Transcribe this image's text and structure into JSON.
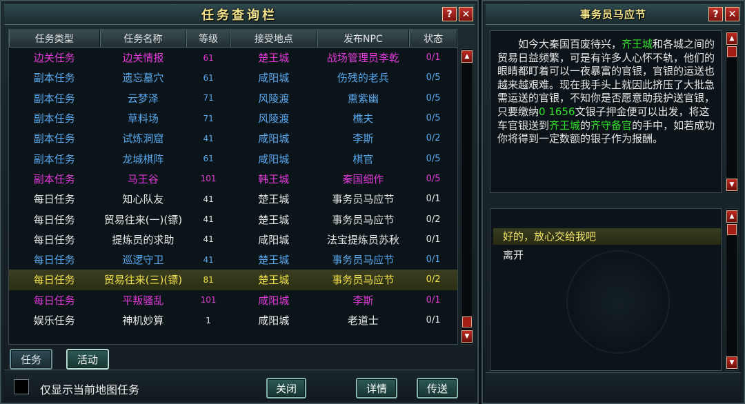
{
  "quest_panel": {
    "title": "任务查询栏",
    "help_label": "?",
    "close_label": "✕",
    "columns": [
      "任务类型",
      "任务名称",
      "等级",
      "接受地点",
      "发布NPC",
      "状态"
    ],
    "rows": [
      {
        "type": "边关任务",
        "name": "边关情报",
        "level": "61",
        "place": "楚王城",
        "npc": "战场管理员李乾",
        "status": "0/1",
        "color": "#e23ad8"
      },
      {
        "type": "副本任务",
        "name": "遗忘墓穴",
        "level": "61",
        "place": "咸阳城",
        "npc": "伤残的老兵",
        "status": "0/5",
        "color": "#5aa9f0"
      },
      {
        "type": "副本任务",
        "name": "云梦泽",
        "level": "71",
        "place": "风陵渡",
        "npc": "熏紫幽",
        "status": "0/5",
        "color": "#5aa9f0"
      },
      {
        "type": "副本任务",
        "name": "草料场",
        "level": "71",
        "place": "风陵渡",
        "npc": "樵夫",
        "status": "0/5",
        "color": "#5aa9f0"
      },
      {
        "type": "副本任务",
        "name": "试炼洞窟",
        "level": "41",
        "place": "咸阳城",
        "npc": "李斯",
        "status": "0/2",
        "color": "#5aa9f0"
      },
      {
        "type": "副本任务",
        "name": "龙城棋阵",
        "level": "61",
        "place": "咸阳城",
        "npc": "棋官",
        "status": "0/5",
        "color": "#5aa9f0"
      },
      {
        "type": "副本任务",
        "name": "马王谷",
        "level": "101",
        "place": "韩王城",
        "npc": "秦国细作",
        "status": "0/5",
        "color": "#e23ad8"
      },
      {
        "type": "每日任务",
        "name": "知心队友",
        "level": "41",
        "place": "楚王城",
        "npc": "事务员马应节",
        "status": "0/1",
        "color": "#e8e8e8"
      },
      {
        "type": "每日任务",
        "name": "贸易往来(一)(镖)",
        "level": "41",
        "place": "楚王城",
        "npc": "事务员马应节",
        "status": "0/2",
        "color": "#e8e8e8"
      },
      {
        "type": "每日任务",
        "name": "提炼员的求助",
        "level": "41",
        "place": "咸阳城",
        "npc": "法宝提炼员苏秋",
        "status": "0/1",
        "color": "#e8e8e8"
      },
      {
        "type": "每日任务",
        "name": "巡逻守卫",
        "level": "41",
        "place": "楚王城",
        "npc": "事务员马应节",
        "status": "0/1",
        "color": "#5aa9f0"
      },
      {
        "type": "每日任务",
        "name": "贸易往来(三)(镖)",
        "level": "81",
        "place": "楚王城",
        "npc": "事务员马应节",
        "status": "0/2",
        "color": "#f2e14a"
      },
      {
        "type": "每日任务",
        "name": "平叛骚乱",
        "level": "101",
        "place": "咸阳城",
        "npc": "李斯",
        "status": "0/1",
        "color": "#e23ad8"
      },
      {
        "type": "娱乐任务",
        "name": "神机妙算",
        "level": "1",
        "place": "咸阳城",
        "npc": "老道士",
        "status": "0/1",
        "color": "#e8e8e8"
      }
    ],
    "selected_row": 11,
    "tabs": [
      "任务",
      "活动"
    ],
    "checkbox_label": "仅显示当前地图任务",
    "close_button": "关闭",
    "detail_button": "详情",
    "teleport_button": "传送"
  },
  "npc_panel": {
    "title": "事务员马应节",
    "help_label": "?",
    "close_label": "✕",
    "dialog": {
      "p1": "如今大秦国百废待兴，",
      "g1": "齐王城",
      "p2": "和各城之间的贸易日益频繁，可是有许多人心怀不轨，他们的眼睛都盯着可以一夜暴富的官银，官银的运送也越来越艰难。现在我手头上就因此挤压了大批急需运送的官银，不知你是否愿意助我护送官银，只要缴纳",
      "g2": "0 1656",
      "p3": "文银子押金便可以出发，将这车官银送到",
      "g3": "齐王城",
      "p4": "的",
      "g4": "齐守备官",
      "p5": "的手中，如若成功你将得到一定数额的银子作为报酬。"
    },
    "options": [
      "好的，放心交给我吧",
      "离开"
    ]
  }
}
